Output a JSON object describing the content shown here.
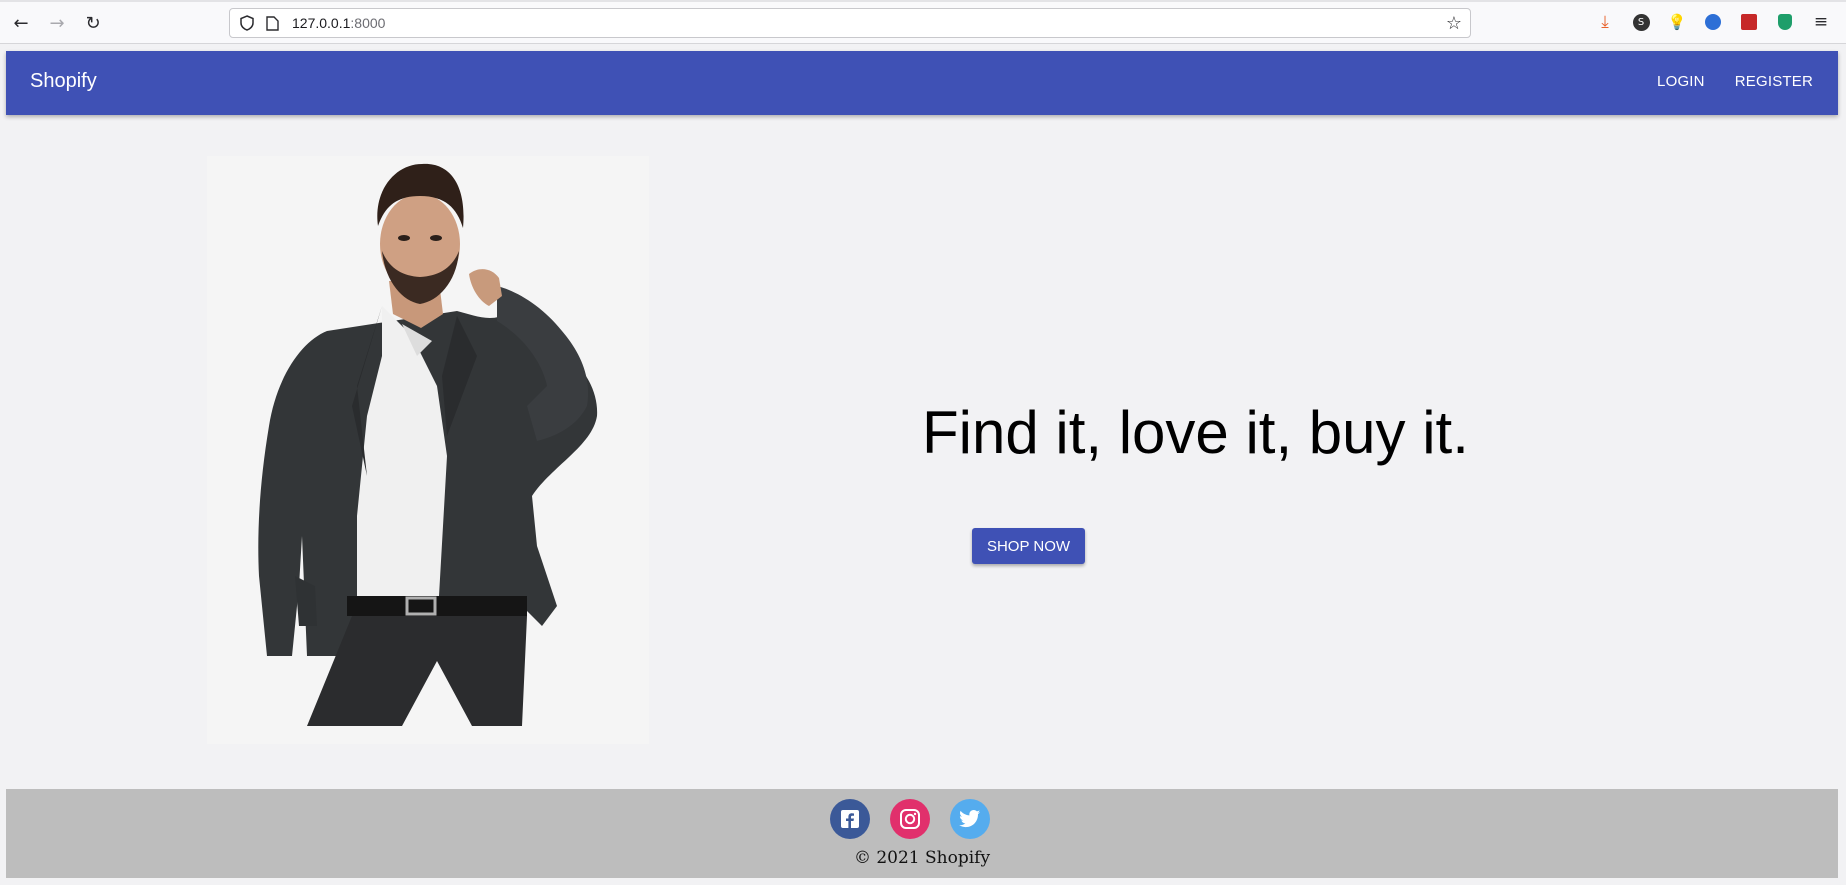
{
  "browser": {
    "url_host": "127.0.0.1",
    "url_port": ":8000"
  },
  "navbar": {
    "brand": "Shopify",
    "links": [
      {
        "label": "LOGIN"
      },
      {
        "label": "REGISTER"
      }
    ],
    "color": "#3f51b5"
  },
  "hero": {
    "image_alt": "Man in dark suit jacket and white shirt",
    "headline": "Find it, love it, buy it.",
    "cta_label": "SHOP NOW"
  },
  "footer": {
    "socials": [
      {
        "name": "facebook-icon",
        "color": "#3b5998"
      },
      {
        "name": "instagram-icon",
        "color": "#e1306c"
      },
      {
        "name": "twitter-icon",
        "color": "#55acee"
      }
    ],
    "copyright": "© 2021 Shopify"
  }
}
